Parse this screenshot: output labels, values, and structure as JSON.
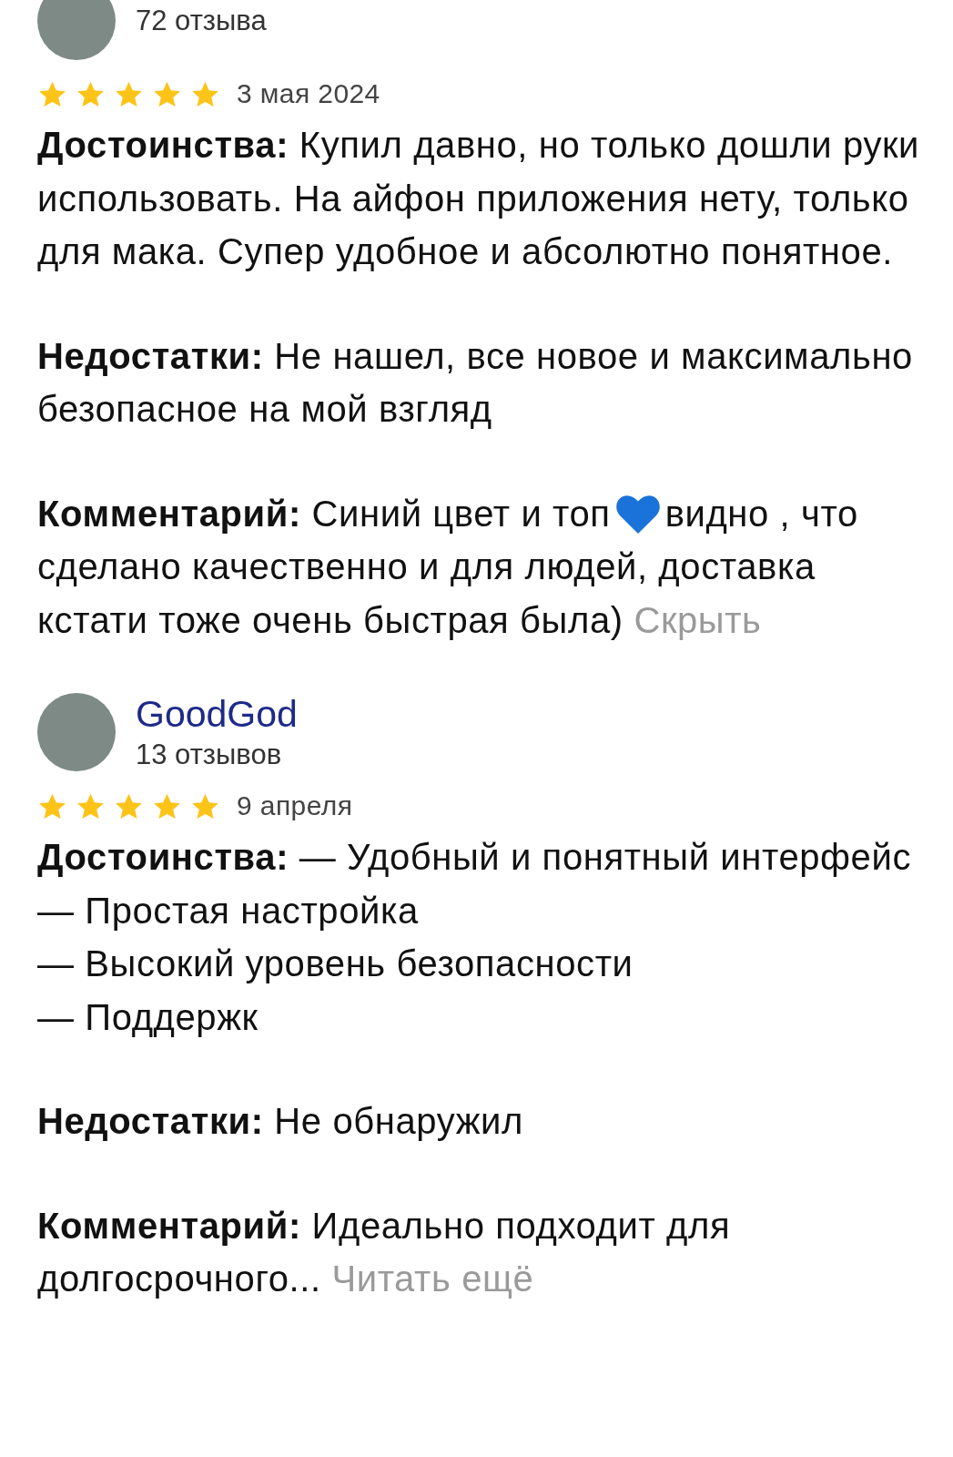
{
  "reviews": [
    {
      "reviews_count": "72 отзыва",
      "stars": 5,
      "date": "3 мая 2024",
      "sections": [
        {
          "segments": [
            {
              "kind": "text",
              "text": "**Достоинства:** Купил давно, но только дошли руки использовать. На айфон приложения нету, только для мака. Супер удобное и абсолютно понятное."
            }
          ]
        },
        {
          "segments": [
            {
              "kind": "text",
              "text": "**Недостатки:** Не нашел, все новое и максимально безопасное на мой взгляд"
            }
          ]
        },
        {
          "segments": [
            {
              "kind": "text",
              "text": "**Комментарий:** Синий цвет и топ"
            },
            {
              "kind": "heart"
            },
            {
              "kind": "text",
              "text": "видно , что сделано качественно и для людей, доставка кстати тоже очень быстрая была)"
            }
          ],
          "link": "Скрыть"
        }
      ]
    },
    {
      "name": "GoodGod",
      "reviews_count": "13 отзывов",
      "stars": 5,
      "date": "9 апреля",
      "sections": [
        {
          "segments": [
            {
              "kind": "text",
              "text": "**Достоинства:** — Удобный и понятный интерфейс\n— Простая настройка\n— Высокий уровень безопасности\n— Поддержк"
            }
          ]
        },
        {
          "segments": [
            {
              "kind": "text",
              "text": "**Недостатки:** Не обнаружил"
            }
          ]
        },
        {
          "segments": [
            {
              "kind": "text",
              "text": "**Комментарий:** Идеально подходит для долгосрочного..."
            }
          ],
          "link": "Читать ещё"
        }
      ]
    }
  ]
}
